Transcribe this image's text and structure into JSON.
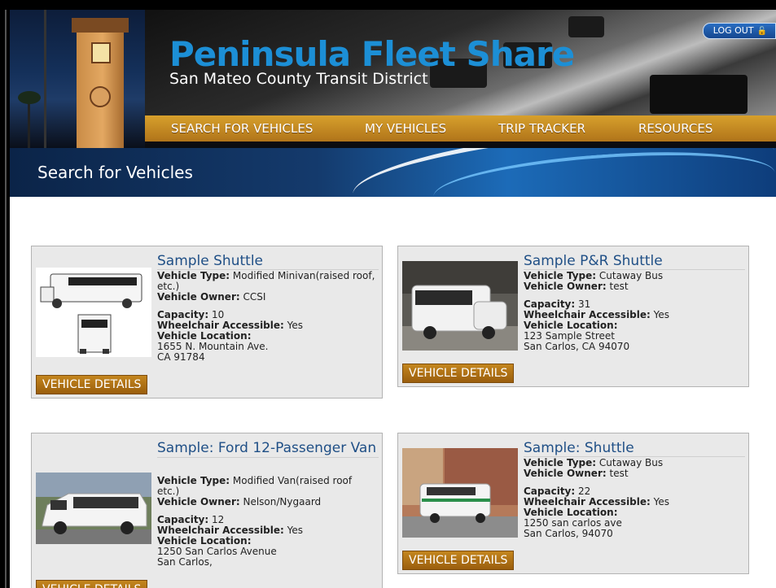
{
  "header": {
    "brand_title": "Peninsula Fleet Share",
    "brand_subtitle": "San Mateo County Transit District",
    "logout_label": "LOG OUT"
  },
  "nav": {
    "items": [
      {
        "label": "SEARCH FOR VEHICLES"
      },
      {
        "label": "MY VEHICLES"
      },
      {
        "label": "TRIP TRACKER"
      },
      {
        "label": "RESOURCES"
      }
    ]
  },
  "banner": {
    "title": "Search for Vehicles"
  },
  "labels": {
    "vehicle_type": "Vehicle Type:",
    "vehicle_owner": "Vehicle Owner:",
    "capacity": "Capacity:",
    "wheelchair": "Wheelchair Accessible:",
    "location": "Vehicle Location:",
    "details_button": "VEHICLE DETAILS"
  },
  "vehicles": [
    {
      "name": "Sample Shuttle",
      "type": "Modified Minivan(raised roof, etc.)",
      "owner": "CCSI",
      "capacity": "10",
      "wheelchair": "Yes",
      "location_line1": "1655 N. Mountain Ave.",
      "location_line2": "CA 91784"
    },
    {
      "name": "Sample P&R Shuttle",
      "type": "Cutaway Bus",
      "owner": "test",
      "capacity": "31",
      "wheelchair": "Yes",
      "location_line1": "123 Sample Street",
      "location_line2": "San Carlos, CA 94070"
    },
    {
      "name": "Sample: Ford 12-Passenger Van",
      "type": "Modified Van(raised roof etc.)",
      "owner": "Nelson/Nygaard",
      "capacity": "12",
      "wheelchair": "Yes",
      "location_line1": "1250 San Carlos Avenue",
      "location_line2": "San Carlos,"
    },
    {
      "name": "Sample: Shuttle",
      "type": "Cutaway Bus",
      "owner": "test",
      "capacity": "22",
      "wheelchair": "Yes",
      "location_line1": "1250 san carlos ave",
      "location_line2": "San Carlos,  94070"
    }
  ]
}
